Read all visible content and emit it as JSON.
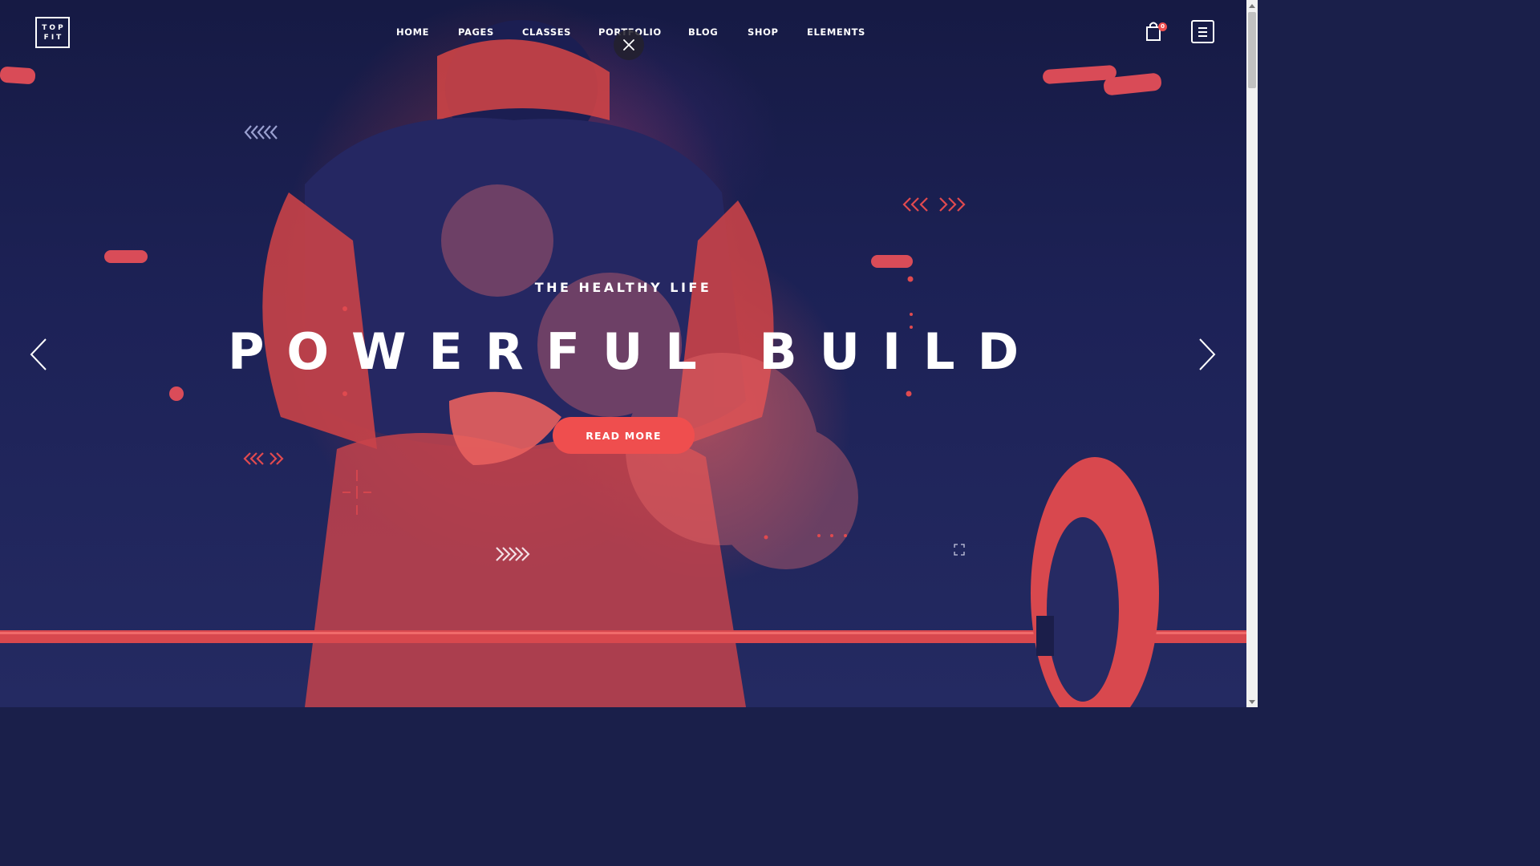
{
  "brand": {
    "logo_line1": "TOP",
    "logo_line2": "FIT"
  },
  "nav": {
    "items": [
      {
        "label": "HOME"
      },
      {
        "label": "PAGES"
      },
      {
        "label": "CLASSES"
      },
      {
        "label": "PORTFOLIO"
      },
      {
        "label": "BLOG"
      },
      {
        "label": "SHOP"
      },
      {
        "label": "ELEMENTS"
      }
    ]
  },
  "cart": {
    "count": "0",
    "icon": "shopping-bag-icon"
  },
  "menu": {
    "icon": "hamburger-menu-icon"
  },
  "close": {
    "icon": "close-icon"
  },
  "slide": {
    "subtitle": "THE HEALTHY LIFE",
    "title": "POWERFUL BUILD",
    "button_label": "READ MORE"
  },
  "slider": {
    "prev_icon": "chevron-left-icon",
    "next_icon": "chevron-right-icon"
  },
  "colors": {
    "accent": "#ef4e4e",
    "overlay_dark": "#1a1f4a",
    "text": "#ffffff"
  }
}
